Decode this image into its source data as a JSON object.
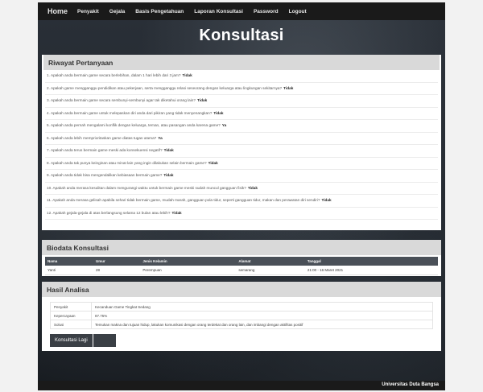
{
  "nav": {
    "home": "Home",
    "items": [
      "Penyakit",
      "Gejala",
      "Basis Pengetahuan",
      "Laporan Konsultasi",
      "Password",
      "Logout"
    ]
  },
  "page_title": "Konsultasi",
  "riwayat": {
    "title": "Riwayat Pertanyaan",
    "questions": [
      {
        "q": "1. Apakah anda bermain game secara berlebihan, dalam 1 hari lebih dari 3 jam?",
        "a": "Tidak"
      },
      {
        "q": "2. Apakah game mengganggu pendidikan atau pekerjaan, serta mengganggu relasi seseorang dengan keluarga atau lingkungan sekitarnya?",
        "a": "Tidak"
      },
      {
        "q": "3. Apakah anda bermain game secara sembunyi-sembunyi agar tak diketahui orang lain?",
        "a": "Tidak"
      },
      {
        "q": "4. Apakah anda bermain game untuk melepaskan diri anda dari pikiran yang tidak menyenangkan?",
        "a": "Tidak"
      },
      {
        "q": "5. Apakah anda pernah mengalami konflik dengan keluarga, teman, atau pasangan anda karena game?",
        "a": "Ya"
      },
      {
        "q": "6. Apakah anda lebih memprioritaskan game diatas tugas utama?",
        "a": "Ya"
      },
      {
        "q": "7. Apakah anda terus bermain game meski ada konsekuensi negatif?",
        "a": "Tidak"
      },
      {
        "q": "8. Apakah anda tak punya keinginan atau minat lain yang ingin dilakukan selain bermain game?",
        "a": "Tidak"
      },
      {
        "q": "9. Apakah anda tidak bisa mengendalikan kebiasaan bermain game?",
        "a": "Tidak"
      },
      {
        "q": "10. Apakah anda merasa kesulitan dalam mengurangi waktu untuk bermain game meski sudah muncul gangguan fisik?",
        "a": "Tidak"
      },
      {
        "q": "11. Apakah anda merasa gelisah apabila sehari tidak bermain game, mudah marah, gangguan pola tidur, seperti gangguan tidur, makan dan perawatan diri sendiri?",
        "a": "Tidak"
      },
      {
        "q": "12. Apakah gejala-gejala di atas berlangsung selama 12 bulan atau lebih?",
        "a": "Tidak"
      }
    ]
  },
  "biodata": {
    "title": "Biodata Konsultasi",
    "headers": [
      "Nama",
      "Umur",
      "Jenis Kelamin",
      "Alamat",
      "Tanggal"
    ],
    "row": [
      "Yanti",
      "28",
      "Perempuan",
      "semarang",
      "21:00 - 16 Maret 2021"
    ]
  },
  "hasil": {
    "title": "Hasil Analisa",
    "rows": [
      {
        "k": "Penyakit",
        "v": "Kecanduan Game Tingkat Sedang"
      },
      {
        "k": "Kepercayaan",
        "v": "87.75%"
      },
      {
        "k": "Solusi",
        "v": "Temukan makna dan tujuan hidup, lakukan komunikasi dengan orang terdekat dan orang lain, dan imbangi dengan aktifitas positif"
      }
    ],
    "button": "Konsultasi Lagi"
  },
  "footer": "Universitas Duta Bangsa"
}
